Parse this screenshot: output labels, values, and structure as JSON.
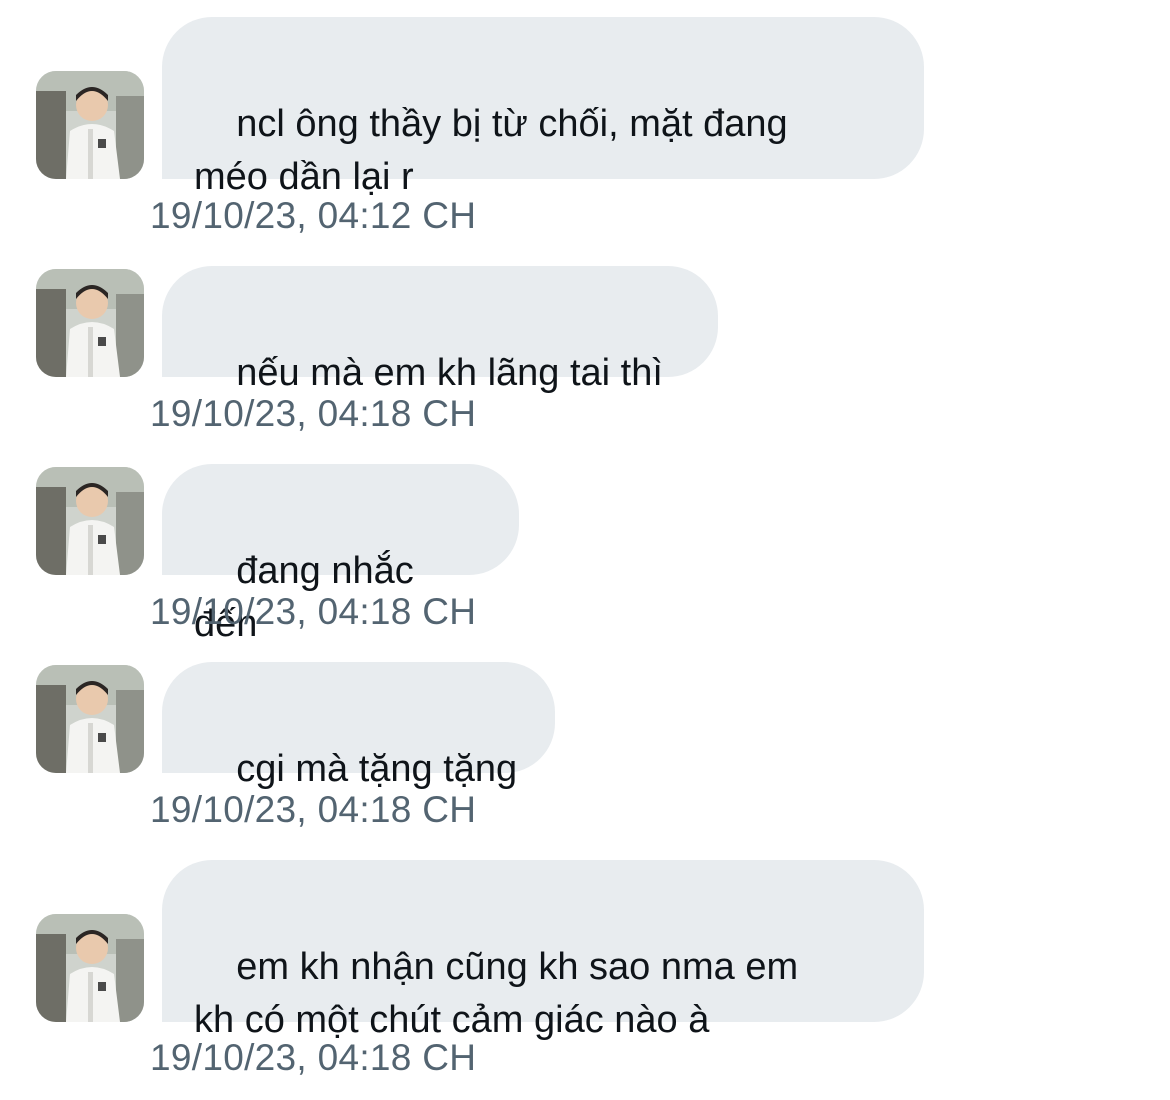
{
  "conversation": {
    "messages": [
      {
        "text": "ncl ông thầy bị từ chối, mặt đang\nméo dần lại r",
        "timestamp": "19/10/23, 04:12 CH"
      },
      {
        "text": "nếu mà em kh lãng tai thì",
        "timestamp": "19/10/23, 04:18 CH"
      },
      {
        "text": "đang nhắc đến",
        "timestamp": "19/10/23, 04:18 CH"
      },
      {
        "text": "cgi mà tặng tặng",
        "timestamp": "19/10/23, 04:18 CH"
      },
      {
        "text": "em kh nhận cũng kh sao nma em\nkh có một chút cảm giác nào à",
        "timestamp": "19/10/23, 04:18 CH"
      }
    ]
  },
  "colors": {
    "bubble_bg": "#e8ecef",
    "message_text": "#0f1419",
    "timestamp_text": "#536471"
  },
  "icons": {
    "avatar": "user-avatar-photo"
  }
}
